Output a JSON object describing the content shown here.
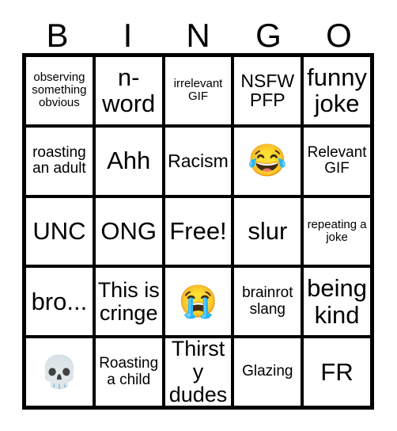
{
  "card": {
    "header_letters": [
      "B",
      "I",
      "N",
      "G",
      "O"
    ],
    "rows": [
      [
        {
          "text": "observing something obvious",
          "size": "sm",
          "kind": "text"
        },
        {
          "text": "n-word",
          "size": "xxl",
          "kind": "text"
        },
        {
          "text": "irrelevant GIF",
          "size": "sm",
          "kind": "text"
        },
        {
          "text": "NSFW PFP",
          "size": "lg",
          "kind": "text"
        },
        {
          "text": "funny joke",
          "size": "xxl",
          "kind": "text"
        }
      ],
      [
        {
          "text": "roasting an adult",
          "size": "md",
          "kind": "text"
        },
        {
          "text": "Ahh",
          "size": "xxl",
          "kind": "text"
        },
        {
          "text": "Racism",
          "size": "lg",
          "kind": "text"
        },
        {
          "text": "😂",
          "size": "emoji",
          "kind": "emoji",
          "emoji_name": "face-with-tears-of-joy-emoji"
        },
        {
          "text": "Relevant GIF",
          "size": "md",
          "kind": "text"
        }
      ],
      [
        {
          "text": "UNC",
          "size": "xxl",
          "kind": "text"
        },
        {
          "text": "ONG",
          "size": "xxl",
          "kind": "text"
        },
        {
          "text": "Free!",
          "size": "xxl",
          "kind": "text"
        },
        {
          "text": "slur",
          "size": "xxl",
          "kind": "text"
        },
        {
          "text": "repeating a joke",
          "size": "sm",
          "kind": "text"
        }
      ],
      [
        {
          "text": "bro...",
          "size": "xxl",
          "kind": "text"
        },
        {
          "text": "This is cringe",
          "size": "xl",
          "kind": "text"
        },
        {
          "text": "😭",
          "size": "emoji",
          "kind": "emoji",
          "emoji_name": "loudly-crying-face-emoji"
        },
        {
          "text": "brainrot slang",
          "size": "md",
          "kind": "text"
        },
        {
          "text": "being kind",
          "size": "xxl",
          "kind": "text"
        }
      ],
      [
        {
          "text": "💀",
          "size": "emoji",
          "kind": "emoji",
          "emoji_name": "skull-emoji"
        },
        {
          "text": "Roasting a child",
          "size": "md",
          "kind": "text"
        },
        {
          "text": "Thirsty dudes",
          "size": "xl",
          "kind": "text"
        },
        {
          "text": "Glazing",
          "size": "md",
          "kind": "text"
        },
        {
          "text": "FR",
          "size": "xxl",
          "kind": "text"
        }
      ]
    ],
    "colors": {
      "background": "#ffffff",
      "border": "#000000",
      "text": "#000000"
    }
  }
}
